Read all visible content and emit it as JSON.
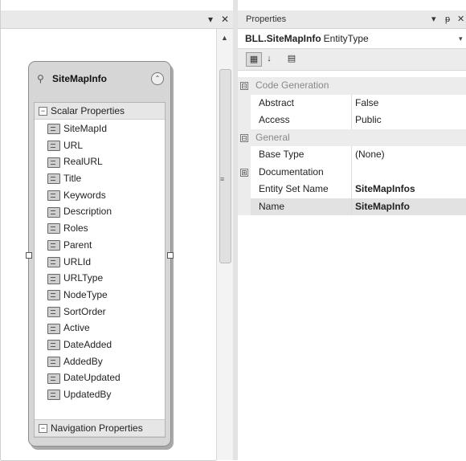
{
  "designer": {
    "titlebar_buttons": {
      "pin": "▾",
      "close": "✕"
    },
    "entity": {
      "title": "SiteMapInfo",
      "icon": "entity-icon",
      "collapse_glyph": "⌃",
      "scalar_section": "Scalar Properties",
      "navigation_section": "Navigation Properties",
      "properties": [
        "SiteMapId",
        "URL",
        "RealURL",
        "Title",
        "Keywords",
        "Description",
        "Roles",
        "Parent",
        "URLId",
        "URLType",
        "NodeType",
        "SortOrder",
        "Active",
        "DateAdded",
        "AddedBy",
        "DateUpdated",
        "UpdatedBy"
      ],
      "key_property_index": 0
    }
  },
  "properties_window": {
    "title": "Properties",
    "title_buttons": {
      "dropdown": "▾",
      "pin": "ᵽ",
      "close": "✕"
    },
    "selector": {
      "object_name": "BLL.SiteMapInfo",
      "object_type": "EntityType",
      "dropdown": "▾"
    },
    "toolbar": {
      "categorized": "▦",
      "alphabetical": "↓",
      "property_pages": "▤"
    },
    "rows": [
      {
        "kind": "category",
        "label": "Code Generation",
        "expand": "⊟"
      },
      {
        "kind": "property",
        "name": "Abstract",
        "value": "False"
      },
      {
        "kind": "property",
        "name": "Access",
        "value": "Public"
      },
      {
        "kind": "category",
        "label": "General",
        "expand": "⊟"
      },
      {
        "kind": "property",
        "name": "Base Type",
        "value": "(None)"
      },
      {
        "kind": "expandable",
        "name": "Documentation",
        "value": "",
        "expand": "⊞"
      },
      {
        "kind": "property",
        "name": "Entity Set Name",
        "value": "SiteMapInfos",
        "bold": true
      },
      {
        "kind": "property",
        "name": "Name",
        "value": "SiteMapInfo",
        "bold": true,
        "selected": true
      }
    ]
  },
  "colors": {
    "entity_fill": "#d6d6d6",
    "category_bg": "#ececec",
    "selected_row_bg": "#e2e2e2"
  }
}
